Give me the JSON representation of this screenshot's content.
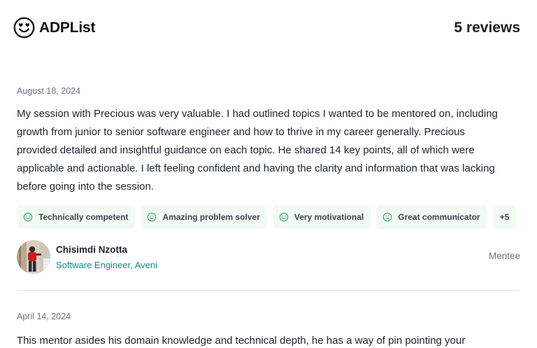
{
  "brand": {
    "name": "ADPList"
  },
  "header": {
    "review_count": "5 reviews"
  },
  "reviews": [
    {
      "date": "August 18, 2024",
      "text": "My session with Precious was very valuable. I had outlined topics I wanted to be mentored on, including growth from junior to senior software engineer and how to thrive in my career generally. Precious provided detailed and insightful guidance on each topic. He shared 14 key points, all of which were applicable and actionable. I left feeling confident and having the clarity and information that was lacking before going into the session.",
      "tags": [
        {
          "label": "Technically competent",
          "icon": "smile-icon"
        },
        {
          "label": "Amazing problem solver",
          "icon": "smile-icon"
        },
        {
          "label": "Very motivational",
          "icon": "smile-icon"
        },
        {
          "label": "Great communicator",
          "icon": "smile-icon"
        }
      ],
      "more_tags": "+5",
      "reviewer": {
        "name": "Chisimdi Nzotta",
        "role": "Software Engineer, Aveni",
        "type": "Mentee"
      }
    },
    {
      "date": "April 14, 2024",
      "text": "This mentor asides his domain knowledge and technical depth, he has a way of pin pointing your"
    }
  ],
  "colors": {
    "tag_background": "#f1faf3",
    "tag_icon": "#3aa76d",
    "role_text": "#0f8b87",
    "divider": "#e5e7eb"
  }
}
